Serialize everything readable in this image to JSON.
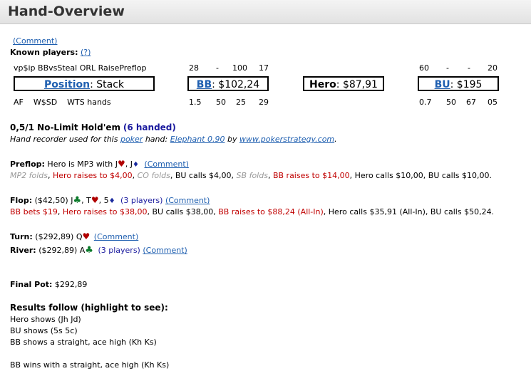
{
  "header": {
    "title": "Hand-Overview"
  },
  "comment_link": "(Comment)",
  "known_players": {
    "label": "Known players:",
    "help": "(?)"
  },
  "stats_top": {
    "labels": "vp$ip BBvsSteal ORL RaisePreflop",
    "bb": [
      "28",
      "-",
      "100",
      "17"
    ],
    "bu": [
      "60",
      "-",
      "-",
      "20"
    ]
  },
  "stats_bottom": {
    "labels": "AF    W$SD    WTS hands",
    "bb": [
      "1.5",
      "50",
      "25",
      "29"
    ],
    "bu": [
      "0.7",
      "50",
      "67",
      "05"
    ]
  },
  "boxes": {
    "position": {
      "link": "Position",
      "rest": ": Stack"
    },
    "bb": {
      "link": "BB",
      "rest": ": $102,24"
    },
    "hero": {
      "bold": "Hero",
      "rest": ": $87,91"
    },
    "bu": {
      "link": "BU",
      "rest": ": $195"
    }
  },
  "game": {
    "title": "0,5/1 No-Limit Hold'em",
    "handed": "(6 handed)",
    "recorder_prefix": "Hand recorder used for this ",
    "poker": "poker",
    "hand": " hand: ",
    "elephant": "Elephant 0.90",
    "by": " by ",
    "site": "www.pokerstrategy.com",
    "dot": "."
  },
  "preflop": {
    "label": "Preflop:",
    "text": " Hero is MP3 with J",
    "comma": ", J",
    "comment": "(Comment)",
    "actions": [
      {
        "t": "MP2 folds",
        "c": "gray"
      },
      {
        "t": ", ",
        "c": ""
      },
      {
        "t": "Hero raises to $4,00",
        "c": "red"
      },
      {
        "t": ", ",
        "c": ""
      },
      {
        "t": "CO folds",
        "c": "gray"
      },
      {
        "t": ", BU calls $4,00, ",
        "c": ""
      },
      {
        "t": "SB folds",
        "c": "gray"
      },
      {
        "t": ", ",
        "c": ""
      },
      {
        "t": "BB raises to $14,00",
        "c": "red"
      },
      {
        "t": ", Hero calls $10,00, BU calls $10,00.",
        "c": ""
      }
    ]
  },
  "flop": {
    "label": "Flop:",
    "pot": " ($42,50) J",
    "c2": ", T",
    "c3": ", 5",
    "players": "(3 players)",
    "comment": "(Comment)",
    "actions": [
      {
        "t": "BB bets $19",
        "c": "red"
      },
      {
        "t": ", ",
        "c": ""
      },
      {
        "t": "Hero raises to $38,00",
        "c": "red"
      },
      {
        "t": ", BU calls $38,00, ",
        "c": ""
      },
      {
        "t": "BB raises to $88,24 (All-In)",
        "c": "red"
      },
      {
        "t": ", Hero calls $35,91 (All-In), BU calls $50,24.",
        "c": ""
      }
    ]
  },
  "turn": {
    "label": "Turn:",
    "pot": " ($292,89) Q",
    "comment": "(Comment)"
  },
  "river": {
    "label": "River:",
    "pot": " ($292,89) A",
    "players": "(3 players)",
    "comment": "(Comment)"
  },
  "final": {
    "label": "Final Pot:",
    "value": " $292,89"
  },
  "results": {
    "title": "Results follow (highlight to see):",
    "lines": [
      "Hero shows (Jh Jd)",
      "BU shows (5s 5c)",
      "BB shows a straight, ace high (Kh Ks)"
    ],
    "winner": "BB wins with a straight, ace high (Kh Ks)"
  },
  "suits": {
    "heart": "♥",
    "diamond": "♦",
    "club": "♣"
  }
}
